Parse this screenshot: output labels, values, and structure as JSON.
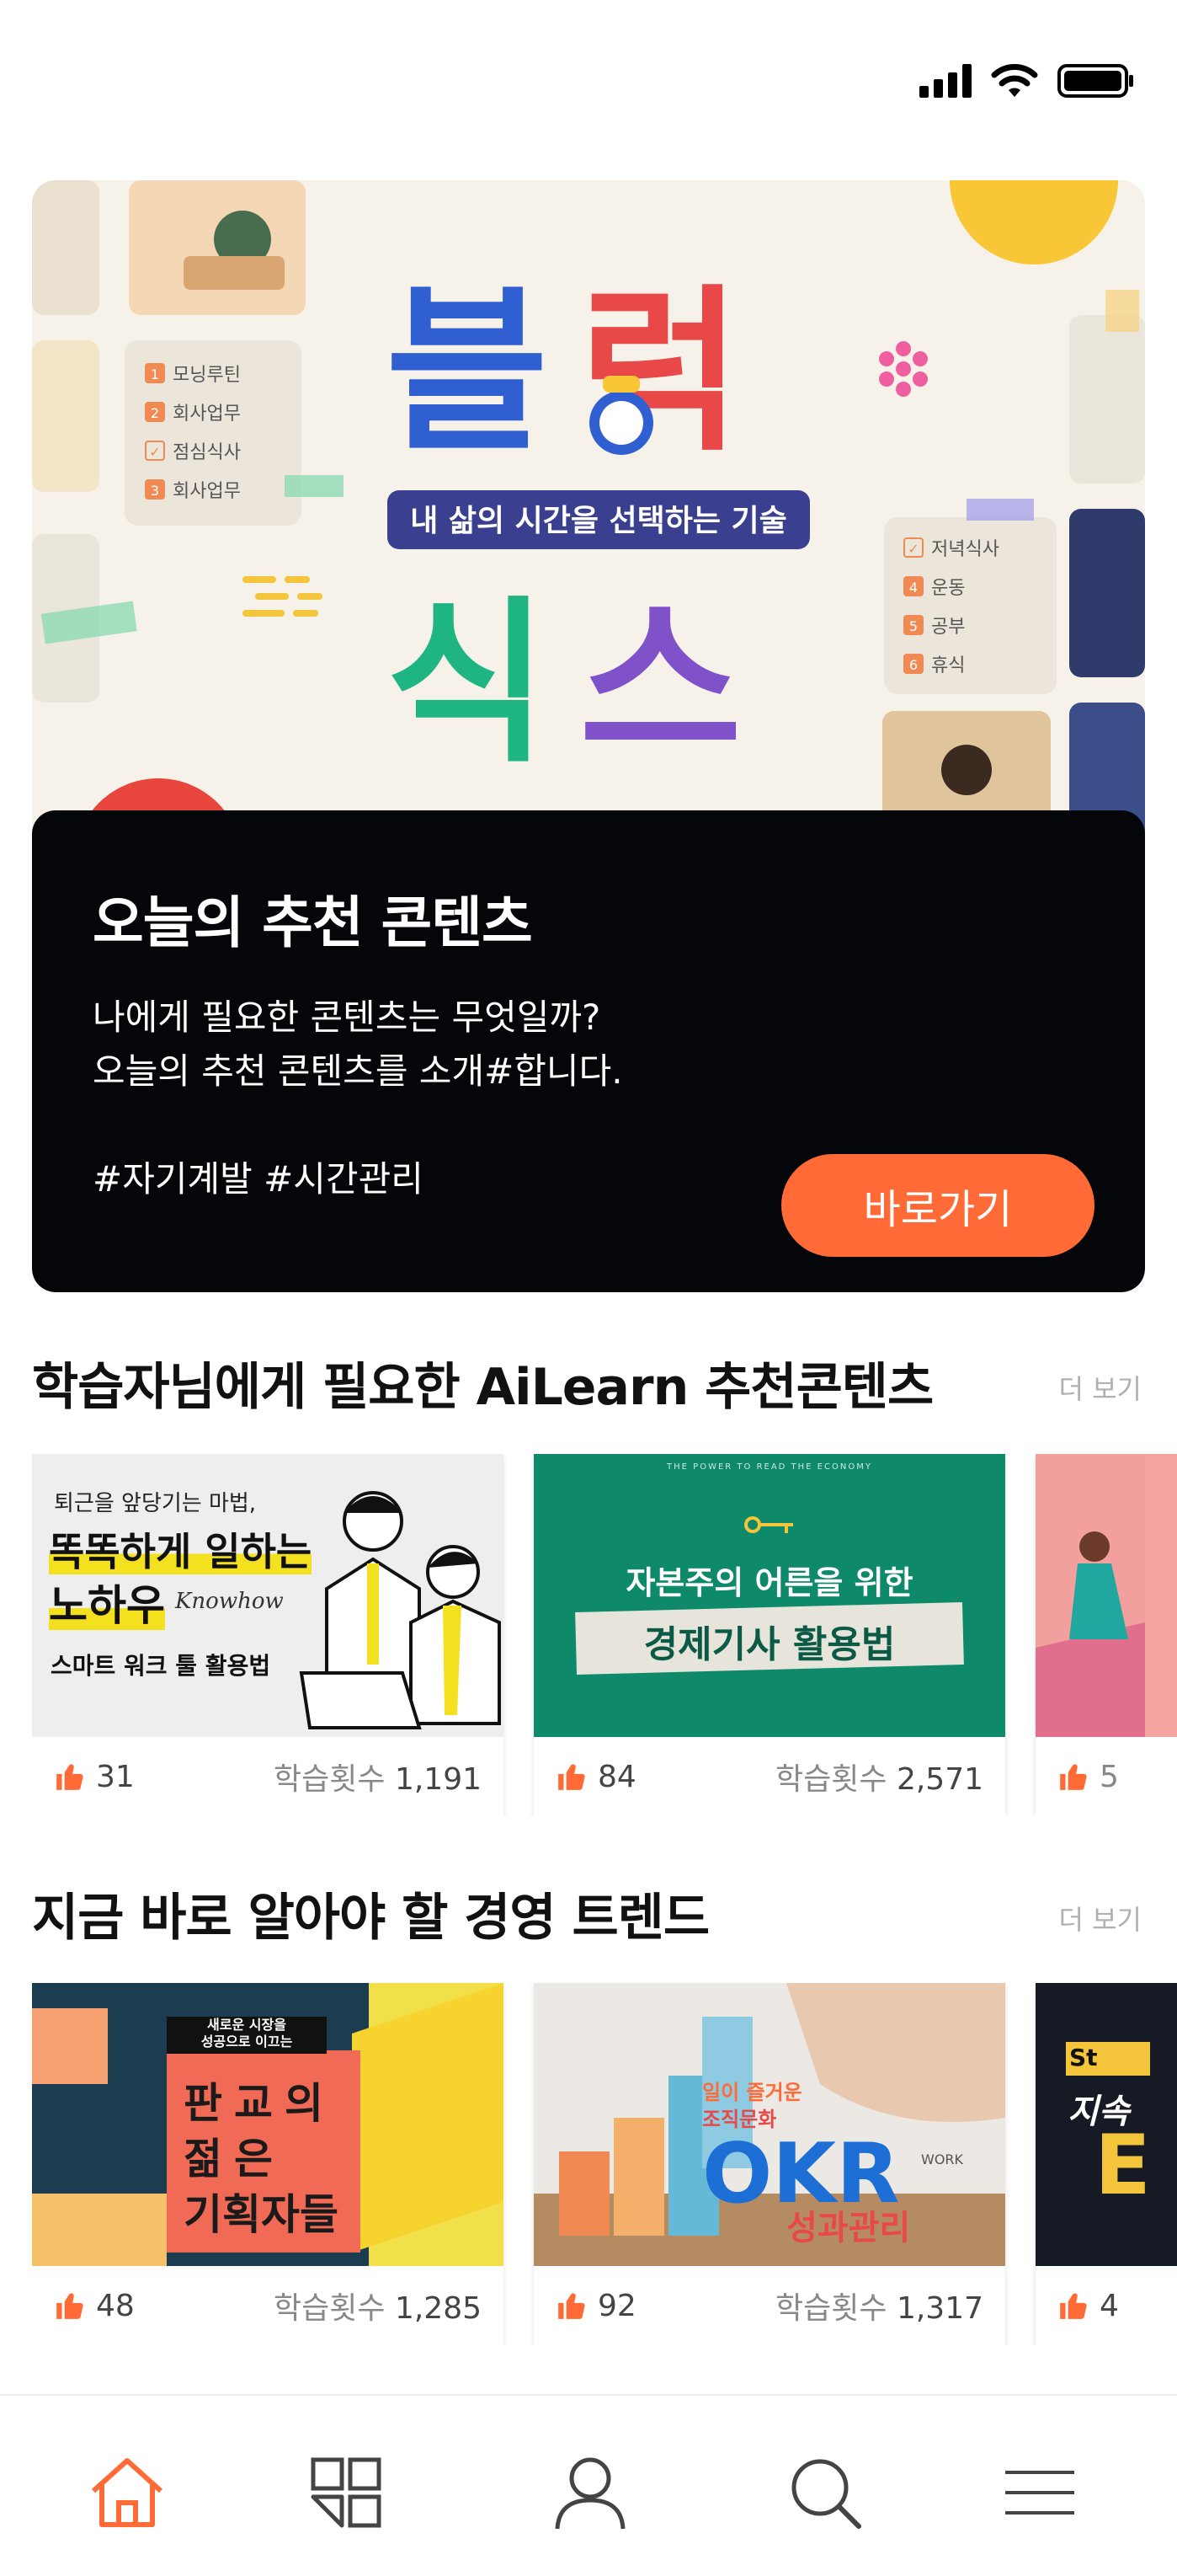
{
  "status_bar": {
    "icons": [
      "signal-icon",
      "wifi-icon",
      "battery-icon"
    ]
  },
  "hero": {
    "art": {
      "title_top": "블럭",
      "title_bottom": "식스",
      "subtitle": "내 삶의 시간을 선택하는 기술",
      "left_list": [
        "모닝루틴",
        "회사업무",
        "점심식사",
        "회사업무"
      ],
      "left_nums": [
        "1",
        "2",
        "✓",
        "3"
      ],
      "right_list": [
        "저녁식사",
        "운동",
        "공부",
        "휴식"
      ],
      "right_nums": [
        "✓",
        "4",
        "5",
        "6"
      ]
    },
    "title": "오늘의 추천 콘텐츠",
    "desc_line1": "나에게 필요한 콘텐츠는 무엇일까?",
    "desc_line2": "오늘의 추천 콘텐츠를 소개#합니다.",
    "tags": "#자기계발 #시간관리",
    "button_label": "바로가기",
    "accent_color": "#ff6a36"
  },
  "section1": {
    "title": "학습자님에게 필요한 AiLearn 추천콘텐츠",
    "more_label": "더 보기",
    "cards": [
      {
        "thumb_lines": [
          "퇴근을 앞당기는 마법,",
          "똑똑하게 일하는",
          "노하우",
          "Knowhow",
          "스마트 워크 툴 활용법"
        ],
        "likes": "31",
        "views_label": "학습횟수",
        "views": "1,191"
      },
      {
        "thumb_lines": [
          "THE POWER TO READ THE ECONOMY",
          "자본주의 어른을 위한",
          "경제기사 활용법"
        ],
        "likes": "84",
        "views_label": "학습횟수",
        "views": "2,571"
      },
      {
        "thumb_lines": [],
        "likes": "5",
        "views_label": "",
        "views": ""
      }
    ]
  },
  "section2": {
    "title": "지금 바로 알아야 할 경영 트렌드",
    "more_label": "더 보기",
    "cards": [
      {
        "thumb_lines": [
          "새로운 시장을",
          "성공으로 이끄는",
          "판교의",
          "젊은",
          "기획자들"
        ],
        "likes": "48",
        "views_label": "학습횟수",
        "views": "1,285"
      },
      {
        "thumb_lines": [
          "일이 즐거운",
          "조직문화",
          "OKR",
          "성과관리",
          "WORK"
        ],
        "likes": "92",
        "views_label": "학습횟수",
        "views": "1,317"
      },
      {
        "thumb_lines": [
          "St",
          "지속",
          "E"
        ],
        "likes": "4",
        "views_label": "",
        "views": ""
      }
    ]
  },
  "nav": {
    "items": [
      "home-icon",
      "grid-icon",
      "user-icon",
      "search-icon",
      "menu-icon"
    ],
    "active_color": "#ff6a36"
  }
}
